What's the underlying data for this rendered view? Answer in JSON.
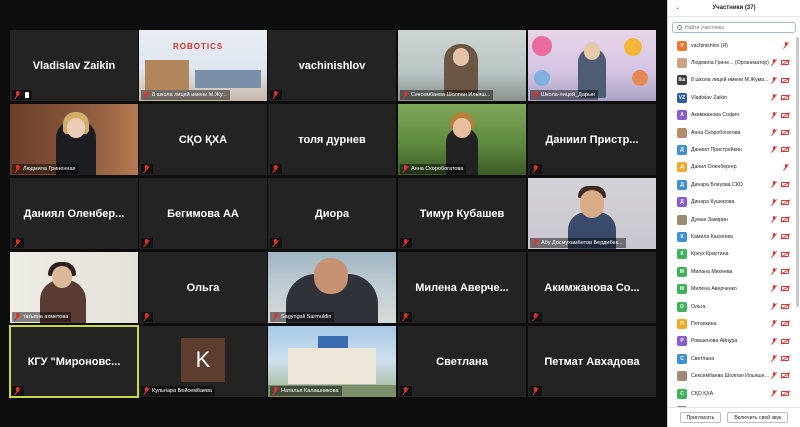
{
  "colors": {
    "accent": "#c7d64a",
    "muted_red": "#e0322f",
    "tile_bg": "#232323"
  },
  "grid": {
    "tiles": [
      {
        "name": "Vladislav Zaikin",
        "caption": "",
        "pinned": true
      },
      {
        "name": "",
        "caption": "8 школа лицей имени М.Жу...",
        "scene": "robotics",
        "sign": "ROBOTICS"
      },
      {
        "name": "vachinishlov",
        "caption": ""
      },
      {
        "name": "",
        "caption": "Сексембаева Шолпан Ильяш...",
        "scene": "office1"
      },
      {
        "name": "",
        "caption": "Школа-лицей_Дарын",
        "scene": "floral"
      },
      {
        "name": "",
        "caption": "Людмила Гриненная",
        "scene": "woman1"
      },
      {
        "name": "СҚО ҚХА",
        "caption": ""
      },
      {
        "name": "толя дурнев",
        "caption": ""
      },
      {
        "name": "",
        "caption": "Анна Скоробогатова",
        "scene": "outdoor"
      },
      {
        "name": "Даниил Пристр...",
        "caption": ""
      },
      {
        "name": "Даниял Оленбер...",
        "caption": ""
      },
      {
        "name": "Бегимова АА",
        "caption": ""
      },
      {
        "name": "Диора",
        "caption": ""
      },
      {
        "name": "Тимур Кубашев",
        "caption": ""
      },
      {
        "name": "",
        "caption": "Абу Досмухамбетов Бердибек...",
        "scene": "boy"
      },
      {
        "name": "",
        "caption": "татьяна ахметова",
        "scene": "woman2"
      },
      {
        "name": "Ольга",
        "caption": ""
      },
      {
        "name": "",
        "caption": "Sagyngali Sarmuldin",
        "scene": "man"
      },
      {
        "name": "Милена Аверче...",
        "caption": ""
      },
      {
        "name": "Акимжанова Со...",
        "caption": ""
      },
      {
        "name": "КГУ \"Мироновс...",
        "caption": "",
        "active": true
      },
      {
        "name": "",
        "caption": "Кульнара Бейсембаева",
        "scene": "avatar",
        "avatar_letter": "K"
      },
      {
        "name": "",
        "caption": "Наталья Калашникова",
        "scene": "building"
      },
      {
        "name": "Светлана",
        "caption": ""
      },
      {
        "name": "Петмат Авхадова",
        "caption": ""
      }
    ]
  },
  "panel": {
    "title": "Участники (37)",
    "search_placeholder": "Найти участника",
    "participants": [
      {
        "initial": "V",
        "color": "#e8792f",
        "name": "vachinishlov (Я)",
        "icons": "mic"
      },
      {
        "initial": "",
        "color": "#c9a384",
        "name": "Людмила Грине... (Организатор)",
        "icons": "both"
      },
      {
        "initial": "8ш",
        "color": "#3d3d3d",
        "name": "8 школа лицей имени М.Жума...",
        "icons": "both"
      },
      {
        "initial": "VZ",
        "color": "#2d5fa8",
        "name": "Vladislav Zaikin",
        "icons": "both"
      },
      {
        "initial": "А",
        "color": "#8a5bd3",
        "name": "Акимжанова София",
        "icons": "both"
      },
      {
        "initial": "",
        "color": "#b58b6a",
        "name": "Анна Скоробогатова",
        "icons": "both"
      },
      {
        "initial": "Д",
        "color": "#3d8fd6",
        "name": "Даниил Пристрейкин",
        "icons": "both"
      },
      {
        "initial": "Д",
        "color": "#f0a928",
        "name": "Данил Оленбергер",
        "icons": "mic"
      },
      {
        "initial": "Д",
        "color": "#3d8fd6",
        "name": "Динара Блеуова СКО",
        "icons": "both"
      },
      {
        "initial": "Д",
        "color": "#8a5bd3",
        "name": "Динара Кушерова",
        "icons": "both"
      },
      {
        "initial": "",
        "color": "#9a8c6e",
        "name": "Думан Закирин",
        "icons": "both"
      },
      {
        "initial": "К",
        "color": "#3d8fd6",
        "name": "Камила Каскеева",
        "icons": "both"
      },
      {
        "initial": "К",
        "color": "#3fb35a",
        "name": "Креук Кристина",
        "icons": "both"
      },
      {
        "initial": "М",
        "color": "#3fb35a",
        "name": "Милана Михеева",
        "icons": "both"
      },
      {
        "initial": "М",
        "color": "#3fb35a",
        "name": "Милена Аверченко",
        "icons": "both"
      },
      {
        "initial": "О",
        "color": "#3fb35a",
        "name": "Ольга",
        "icons": "both"
      },
      {
        "initial": "П",
        "color": "#f0a928",
        "name": "Потапкина",
        "icons": "both"
      },
      {
        "initial": "Р",
        "color": "#8a5bd3",
        "name": "Ровшенова Айнура",
        "icons": "both"
      },
      {
        "initial": "С",
        "color": "#3d8fd6",
        "name": "Светлана",
        "icons": "both"
      },
      {
        "initial": "",
        "color": "#a08a76",
        "name": "Сексембаева Шолпан Ильяшев...",
        "icons": "both"
      },
      {
        "initial": "С",
        "color": "#3fb35a",
        "name": "СҚО ҚХА",
        "icons": "both"
      },
      {
        "initial": "",
        "color": "#8f7b6f",
        "name": "татьяна ахметова",
        "icons": "both"
      }
    ],
    "invite_label": "Пригласить",
    "unmute_label": "Включить свой звук"
  }
}
